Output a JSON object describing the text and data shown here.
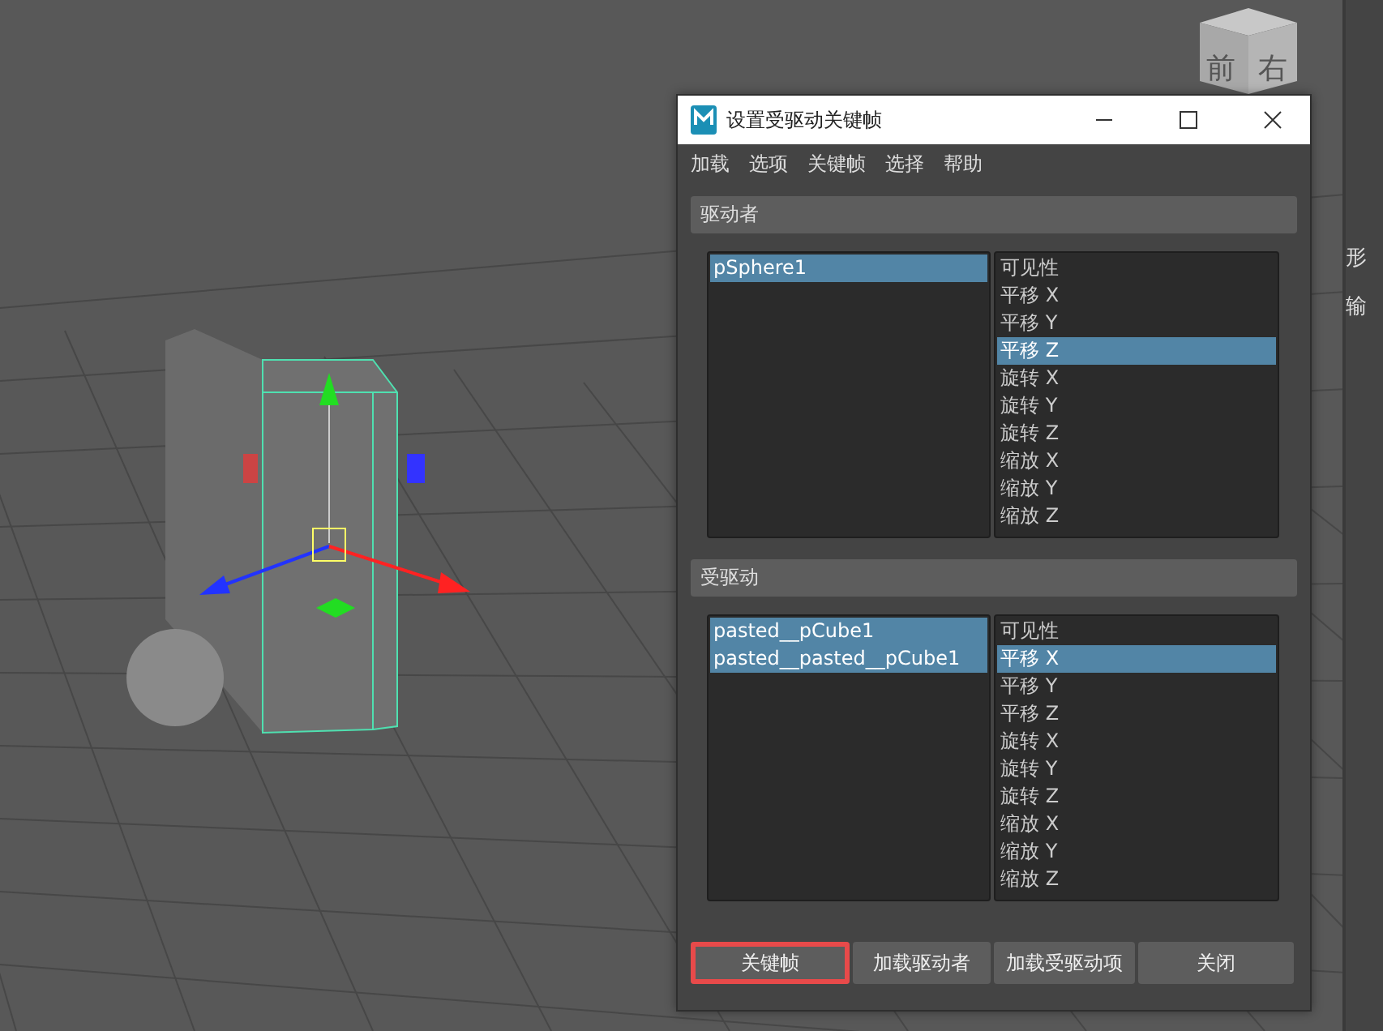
{
  "viewport": {
    "viewcube": {
      "faces": [
        "前",
        "右"
      ]
    }
  },
  "dialog": {
    "title": "设置受驱动关键帧",
    "menu": [
      "加载",
      "选项",
      "关键帧",
      "选择",
      "帮助"
    ],
    "sections": [
      {
        "header": "驱动者",
        "objects": [
          {
            "label": "pSphere1",
            "selected": true
          }
        ],
        "attributes": [
          {
            "label": "可见性",
            "selected": false
          },
          {
            "label": "平移 X",
            "selected": false
          },
          {
            "label": "平移 Y",
            "selected": false
          },
          {
            "label": "平移 Z",
            "selected": true
          },
          {
            "label": "旋转 X",
            "selected": false
          },
          {
            "label": "旋转 Y",
            "selected": false
          },
          {
            "label": "旋转 Z",
            "selected": false
          },
          {
            "label": "缩放 X",
            "selected": false
          },
          {
            "label": "缩放 Y",
            "selected": false
          },
          {
            "label": "缩放 Z",
            "selected": false
          }
        ]
      },
      {
        "header": "受驱动",
        "objects": [
          {
            "label": "pasted__pCube1",
            "selected": true
          },
          {
            "label": "pasted__pasted__pCube1",
            "selected": true
          }
        ],
        "attributes": [
          {
            "label": "可见性",
            "selected": false
          },
          {
            "label": "平移 X",
            "selected": true
          },
          {
            "label": "平移 Y",
            "selected": false
          },
          {
            "label": "平移 Z",
            "selected": false
          },
          {
            "label": "旋转 X",
            "selected": false
          },
          {
            "label": "旋转 Y",
            "selected": false
          },
          {
            "label": "旋转 Z",
            "selected": false
          },
          {
            "label": "缩放 X",
            "selected": false
          },
          {
            "label": "缩放 Y",
            "selected": false
          },
          {
            "label": "缩放 Z",
            "selected": false
          }
        ]
      }
    ],
    "buttons": [
      {
        "label": "关键帧",
        "highlighted": true
      },
      {
        "label": "加载驱动者",
        "highlighted": false
      },
      {
        "label": "加载受驱动项",
        "highlighted": false
      },
      {
        "label": "关闭",
        "highlighted": false
      }
    ]
  },
  "side_panel": {
    "labels": [
      "形",
      "输"
    ]
  }
}
